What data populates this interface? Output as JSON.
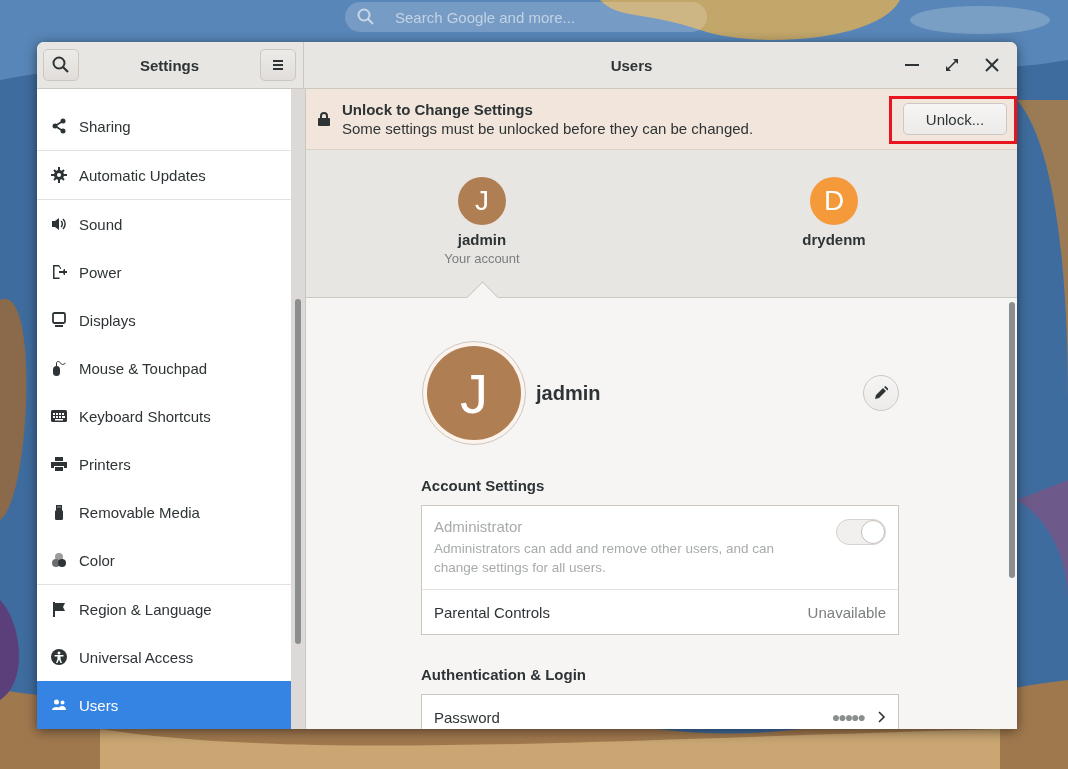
{
  "desktop": {
    "search": {
      "placeholder": "Search Google and more..."
    }
  },
  "window": {
    "sidebar_title": "Settings",
    "title": "Users"
  },
  "sidebar": {
    "items": [
      {
        "label": "Sharing",
        "selected": false
      },
      {
        "label": "Automatic Updates",
        "selected": false
      },
      {
        "label": "Sound",
        "selected": false
      },
      {
        "label": "Power",
        "selected": false
      },
      {
        "label": "Displays",
        "selected": false
      },
      {
        "label": "Mouse & Touchpad",
        "selected": false
      },
      {
        "label": "Keyboard Shortcuts",
        "selected": false
      },
      {
        "label": "Printers",
        "selected": false
      },
      {
        "label": "Removable Media",
        "selected": false
      },
      {
        "label": "Color",
        "selected": false
      },
      {
        "label": "Region & Language",
        "selected": false
      },
      {
        "label": "Universal Access",
        "selected": false
      },
      {
        "label": "Users",
        "selected": true
      }
    ]
  },
  "banner": {
    "title": "Unlock to Change Settings",
    "text": "Some settings must be unlocked before they can be changed.",
    "button": "Unlock...",
    "highlighted": true
  },
  "users": [
    {
      "initial": "J",
      "name": "jadmin",
      "subtitle": "Your account",
      "color": "#b07e53",
      "selected": true
    },
    {
      "initial": "D",
      "name": "drydenm",
      "color": "#f49a3b",
      "selected": false
    }
  ],
  "profile": {
    "initial": "J",
    "name": "jadmin",
    "color": "#b07e53"
  },
  "sections": [
    {
      "title": "Account Settings",
      "rows": [
        {
          "kind": "switch",
          "label": "Administrator",
          "description": "Administrators can add and remove other users, and can change settings for all users.",
          "on": true,
          "disabled": true
        },
        {
          "kind": "value",
          "label": "Parental Controls",
          "value": "Unavailable"
        }
      ]
    },
    {
      "title": "Authentication & Login",
      "rows": [
        {
          "kind": "link",
          "label": "Password",
          "value": "●●●●●"
        }
      ]
    }
  ]
}
